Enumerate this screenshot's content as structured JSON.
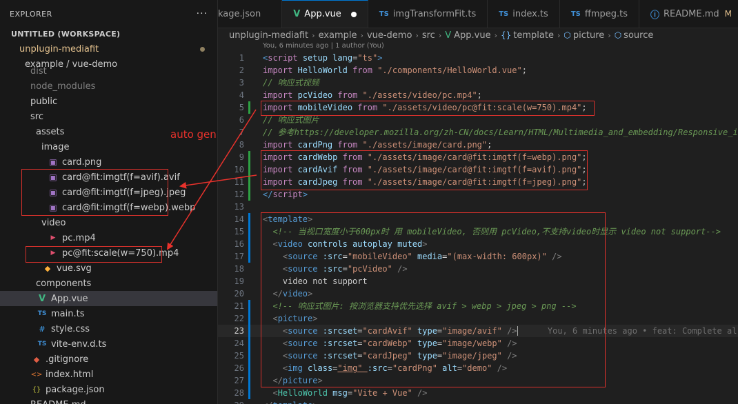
{
  "sidebar": {
    "title": "EXPLORER",
    "more": "···",
    "items": [
      {
        "label": "UNTITLED (WORKSPACE)",
        "chev": "∨",
        "icon": "",
        "indent": 0
      },
      {
        "label": "unplugin-mediafit",
        "chev": "∨",
        "icon": "",
        "indent": 1
      },
      {
        "label": "example / vue-demo",
        "chev": "∨",
        "icon": "",
        "indent": 2
      },
      {
        "label": "dist",
        "chev": "",
        "icon": "",
        "indent": 3
      },
      {
        "label": "node_modules",
        "chev": ">",
        "icon": "",
        "indent": 3
      },
      {
        "label": "public",
        "chev": ">",
        "icon": "",
        "indent": 3
      },
      {
        "label": "src",
        "chev": "∨",
        "icon": "",
        "indent": 3
      },
      {
        "label": "assets",
        "chev": "∨",
        "icon": "",
        "indent": 4
      },
      {
        "label": "image",
        "chev": "∨",
        "icon": "",
        "indent": 5
      },
      {
        "label": "card.png",
        "chev": "",
        "icon": "image-file-icon",
        "indent": 6
      },
      {
        "label": "card@fit:imgtf(f=avif).avif",
        "chev": "",
        "icon": "image-file-icon",
        "indent": 6
      },
      {
        "label": "card@fit:imgtf(f=jpeg).jpeg",
        "chev": "",
        "icon": "image-file-icon",
        "indent": 6
      },
      {
        "label": "card@fit:imgtf(f=webp).webp",
        "chev": "",
        "icon": "image-file-icon",
        "indent": 6
      },
      {
        "label": "video",
        "chev": "∨",
        "icon": "",
        "indent": 5
      },
      {
        "label": "pc.mp4",
        "chev": "",
        "icon": "video-file-icon",
        "indent": 6
      },
      {
        "label": "pc@fit:scale(w=750).mp4",
        "chev": "",
        "icon": "video-file-icon",
        "indent": 6
      },
      {
        "label": "vue.svg",
        "chev": "",
        "icon": "svg-file-icon",
        "indent": 5
      },
      {
        "label": "components",
        "chev": ">",
        "icon": "",
        "indent": 4
      },
      {
        "label": "App.vue",
        "chev": "",
        "icon": "vue-file-icon",
        "indent": 4
      },
      {
        "label": "main.ts",
        "chev": "",
        "icon": "ts-file-icon",
        "indent": 4
      },
      {
        "label": "style.css",
        "chev": "",
        "icon": "css-file-icon",
        "indent": 4
      },
      {
        "label": "vite-env.d.ts",
        "chev": "",
        "icon": "ts-file-icon",
        "indent": 4
      },
      {
        "label": ".gitignore",
        "chev": "",
        "icon": "git-file-icon",
        "indent": 3
      },
      {
        "label": "index.html",
        "chev": "",
        "icon": "html-file-icon",
        "indent": 3
      },
      {
        "label": "package.json",
        "chev": "",
        "icon": "json-file-icon",
        "indent": 3
      },
      {
        "label": "README.md",
        "chev": "",
        "icon": "",
        "indent": 3
      }
    ],
    "icon_glyphs": {
      "image-file-icon": "▣",
      "video-file-icon": "▶",
      "svg-file-icon": "◆",
      "vue-file-icon": "V",
      "ts-file-icon": "TS",
      "css-file-icon": "#",
      "git-file-icon": "◆",
      "html-file-icon": "<>",
      "json-file-icon": "{}"
    }
  },
  "annotation": {
    "label": "auto gen"
  },
  "tabs": [
    {
      "label": "kage.json",
      "icon": "",
      "icon_type": ""
    },
    {
      "label": "App.vue",
      "icon": "V",
      "icon_type": "vue",
      "active": true,
      "dirty": true
    },
    {
      "label": "imgTransformFit.ts",
      "icon": "TS",
      "icon_type": "ts"
    },
    {
      "label": "index.ts",
      "icon": "TS",
      "icon_type": "ts"
    },
    {
      "label": "ffmpeg.ts",
      "icon": "TS",
      "icon_type": "ts"
    },
    {
      "label": "README.md",
      "icon": "ⓘ",
      "icon_type": "info",
      "flag": "M"
    }
  ],
  "breadcrumb": [
    "unplugin-mediafit",
    "example",
    "vue-demo",
    "src",
    "App.vue",
    "template",
    "picture",
    "source"
  ],
  "blame_header": "You, 6 minutes ago | 1 author (You)",
  "inline_blame": "You, 6 minutes ago • feat: Complete al",
  "current_line": 23,
  "code": [
    [
      [
        "t",
        "<"
      ],
      [
        "k",
        "script "
      ],
      [
        "at",
        "setup "
      ],
      [
        "at",
        "lang"
      ],
      [
        "p",
        "="
      ],
      [
        "s",
        "\"ts\""
      ],
      [
        "t",
        ">"
      ]
    ],
    [
      [
        "k",
        "import "
      ],
      [
        "v",
        "HelloWorld "
      ],
      [
        "k",
        "from "
      ],
      [
        "s",
        "\"./components/HelloWorld.vue\""
      ],
      [
        "p",
        ";"
      ]
    ],
    [
      [
        "c",
        "// 响应式视频"
      ]
    ],
    [
      [
        "k",
        "import "
      ],
      [
        "v",
        "pcVideo "
      ],
      [
        "k",
        "from "
      ],
      [
        "s",
        "\"./assets/video/pc.mp4\""
      ],
      [
        "p",
        ";"
      ]
    ],
    [
      [
        "k",
        "import "
      ],
      [
        "v",
        "mobileVideo "
      ],
      [
        "k",
        "from "
      ],
      [
        "s",
        "\"./assets/video/pc@fit:scale(w=750).mp4\""
      ],
      [
        "p",
        ";"
      ]
    ],
    [
      [
        "c",
        "// 响应式图片"
      ]
    ],
    [
      [
        "c",
        "// 参考https://developer.mozilla.org/zh-CN/docs/Learn/HTML/Multimedia_and_embedding/Responsive_i"
      ]
    ],
    [
      [
        "k",
        "import "
      ],
      [
        "v",
        "cardPng "
      ],
      [
        "k",
        "from "
      ],
      [
        "s",
        "\"./assets/image/card.png\""
      ],
      [
        "p",
        ";"
      ]
    ],
    [
      [
        "k",
        "import "
      ],
      [
        "v",
        "cardWebp "
      ],
      [
        "k",
        "from "
      ],
      [
        "s",
        "\"./assets/image/card@fit:imgtf(f=webp).png\""
      ],
      [
        "p",
        ";"
      ]
    ],
    [
      [
        "k",
        "import "
      ],
      [
        "v",
        "cardAvif "
      ],
      [
        "k",
        "from "
      ],
      [
        "s",
        "\"./assets/image/card@fit:imgtf(f=avif).png\""
      ],
      [
        "p",
        ";"
      ]
    ],
    [
      [
        "k",
        "import "
      ],
      [
        "v",
        "cardJpeg "
      ],
      [
        "k",
        "from "
      ],
      [
        "s",
        "\"./assets/image/card@fit:imgtf(f=jpeg).png\""
      ],
      [
        "p",
        ";"
      ]
    ],
    [
      [
        "t",
        "</"
      ],
      [
        "k",
        "script"
      ],
      [
        "t",
        ">"
      ]
    ],
    [],
    [
      [
        "tg",
        "<"
      ],
      [
        "tn",
        "template"
      ],
      [
        "tg",
        ">"
      ]
    ],
    [
      [
        "p",
        "  "
      ],
      [
        "c",
        "<!-- 当视口宽度小于600px时 用 mobileVideo, 否则用 pcVideo,不支持video时显示 video not support-->"
      ]
    ],
    [
      [
        "p",
        "  "
      ],
      [
        "tg",
        "<"
      ],
      [
        "tn",
        "video "
      ],
      [
        "at",
        "controls "
      ],
      [
        "at",
        "autoplay "
      ],
      [
        "at",
        "muted"
      ],
      [
        "tg",
        ">"
      ]
    ],
    [
      [
        "p",
        "    "
      ],
      [
        "tg",
        "<"
      ],
      [
        "tn",
        "source "
      ],
      [
        "at",
        ":src"
      ],
      [
        "p",
        "="
      ],
      [
        "s",
        "\"mobileVideo\" "
      ],
      [
        "at",
        "media"
      ],
      [
        "p",
        "="
      ],
      [
        "s",
        "\"(max-width: 600px)\" "
      ],
      [
        "tg",
        "/>"
      ]
    ],
    [
      [
        "p",
        "    "
      ],
      [
        "tg",
        "<"
      ],
      [
        "tn",
        "source "
      ],
      [
        "at",
        ":src"
      ],
      [
        "p",
        "="
      ],
      [
        "s",
        "\"pcVideo\" "
      ],
      [
        "tg",
        "/>"
      ]
    ],
    [
      [
        "p",
        "    video not support"
      ]
    ],
    [
      [
        "p",
        "  "
      ],
      [
        "tg",
        "</"
      ],
      [
        "tn",
        "video"
      ],
      [
        "tg",
        ">"
      ]
    ],
    [
      [
        "p",
        "  "
      ],
      [
        "c",
        "<!-- 响应式图片: 按浏览器支持优先选择 avif > webp > jpeg > png -->"
      ]
    ],
    [
      [
        "p",
        "  "
      ],
      [
        "tg",
        "<"
      ],
      [
        "tn",
        "picture"
      ],
      [
        "tg",
        ">"
      ]
    ],
    [
      [
        "p",
        "    "
      ],
      [
        "tg",
        "<"
      ],
      [
        "tn",
        "source "
      ],
      [
        "at",
        ":srcset"
      ],
      [
        "p",
        "="
      ],
      [
        "s",
        "\"cardAvif\" "
      ],
      [
        "at",
        "type"
      ],
      [
        "p",
        "="
      ],
      [
        "s",
        "\"image/avif\" "
      ],
      [
        "tg",
        "/>"
      ]
    ],
    [
      [
        "p",
        "    "
      ],
      [
        "tg",
        "<"
      ],
      [
        "tn",
        "source "
      ],
      [
        "at",
        ":srcset"
      ],
      [
        "p",
        "="
      ],
      [
        "s",
        "\"cardWebp\" "
      ],
      [
        "at",
        "type"
      ],
      [
        "p",
        "="
      ],
      [
        "s",
        "\"image/webp\" "
      ],
      [
        "tg",
        "/>"
      ]
    ],
    [
      [
        "p",
        "    "
      ],
      [
        "tg",
        "<"
      ],
      [
        "tn",
        "source "
      ],
      [
        "at",
        ":srcset"
      ],
      [
        "p",
        "="
      ],
      [
        "s",
        "\"cardJpeg\" "
      ],
      [
        "at",
        "type"
      ],
      [
        "p",
        "="
      ],
      [
        "s",
        "\"image/jpeg\" "
      ],
      [
        "tg",
        "/>"
      ]
    ],
    [
      [
        "p",
        "    "
      ],
      [
        "tg",
        "<"
      ],
      [
        "tn",
        "img "
      ],
      [
        "at",
        "class"
      ],
      [
        "p",
        "="
      ],
      [
        "s",
        "\"img\" "
      ],
      [
        "at",
        ":src"
      ],
      [
        "p",
        "="
      ],
      [
        "s",
        "\"cardPng\" "
      ],
      [
        "at",
        "alt"
      ],
      [
        "p",
        "="
      ],
      [
        "s",
        "\"demo\" "
      ],
      [
        "tg",
        "/>"
      ]
    ],
    [
      [
        "p",
        "  "
      ],
      [
        "tg",
        "</"
      ],
      [
        "tn",
        "picture"
      ],
      [
        "tg",
        ">"
      ]
    ],
    [
      [
        "p",
        "  "
      ],
      [
        "tg",
        "<"
      ],
      [
        "cmp",
        "HelloWorld "
      ],
      [
        "at",
        "msg"
      ],
      [
        "p",
        "="
      ],
      [
        "s",
        "\"Vite + Vue\" "
      ],
      [
        "tg",
        "/>"
      ]
    ],
    [
      [
        "tg",
        "</"
      ],
      [
        "tn",
        "template"
      ],
      [
        "tg",
        ">"
      ]
    ]
  ]
}
